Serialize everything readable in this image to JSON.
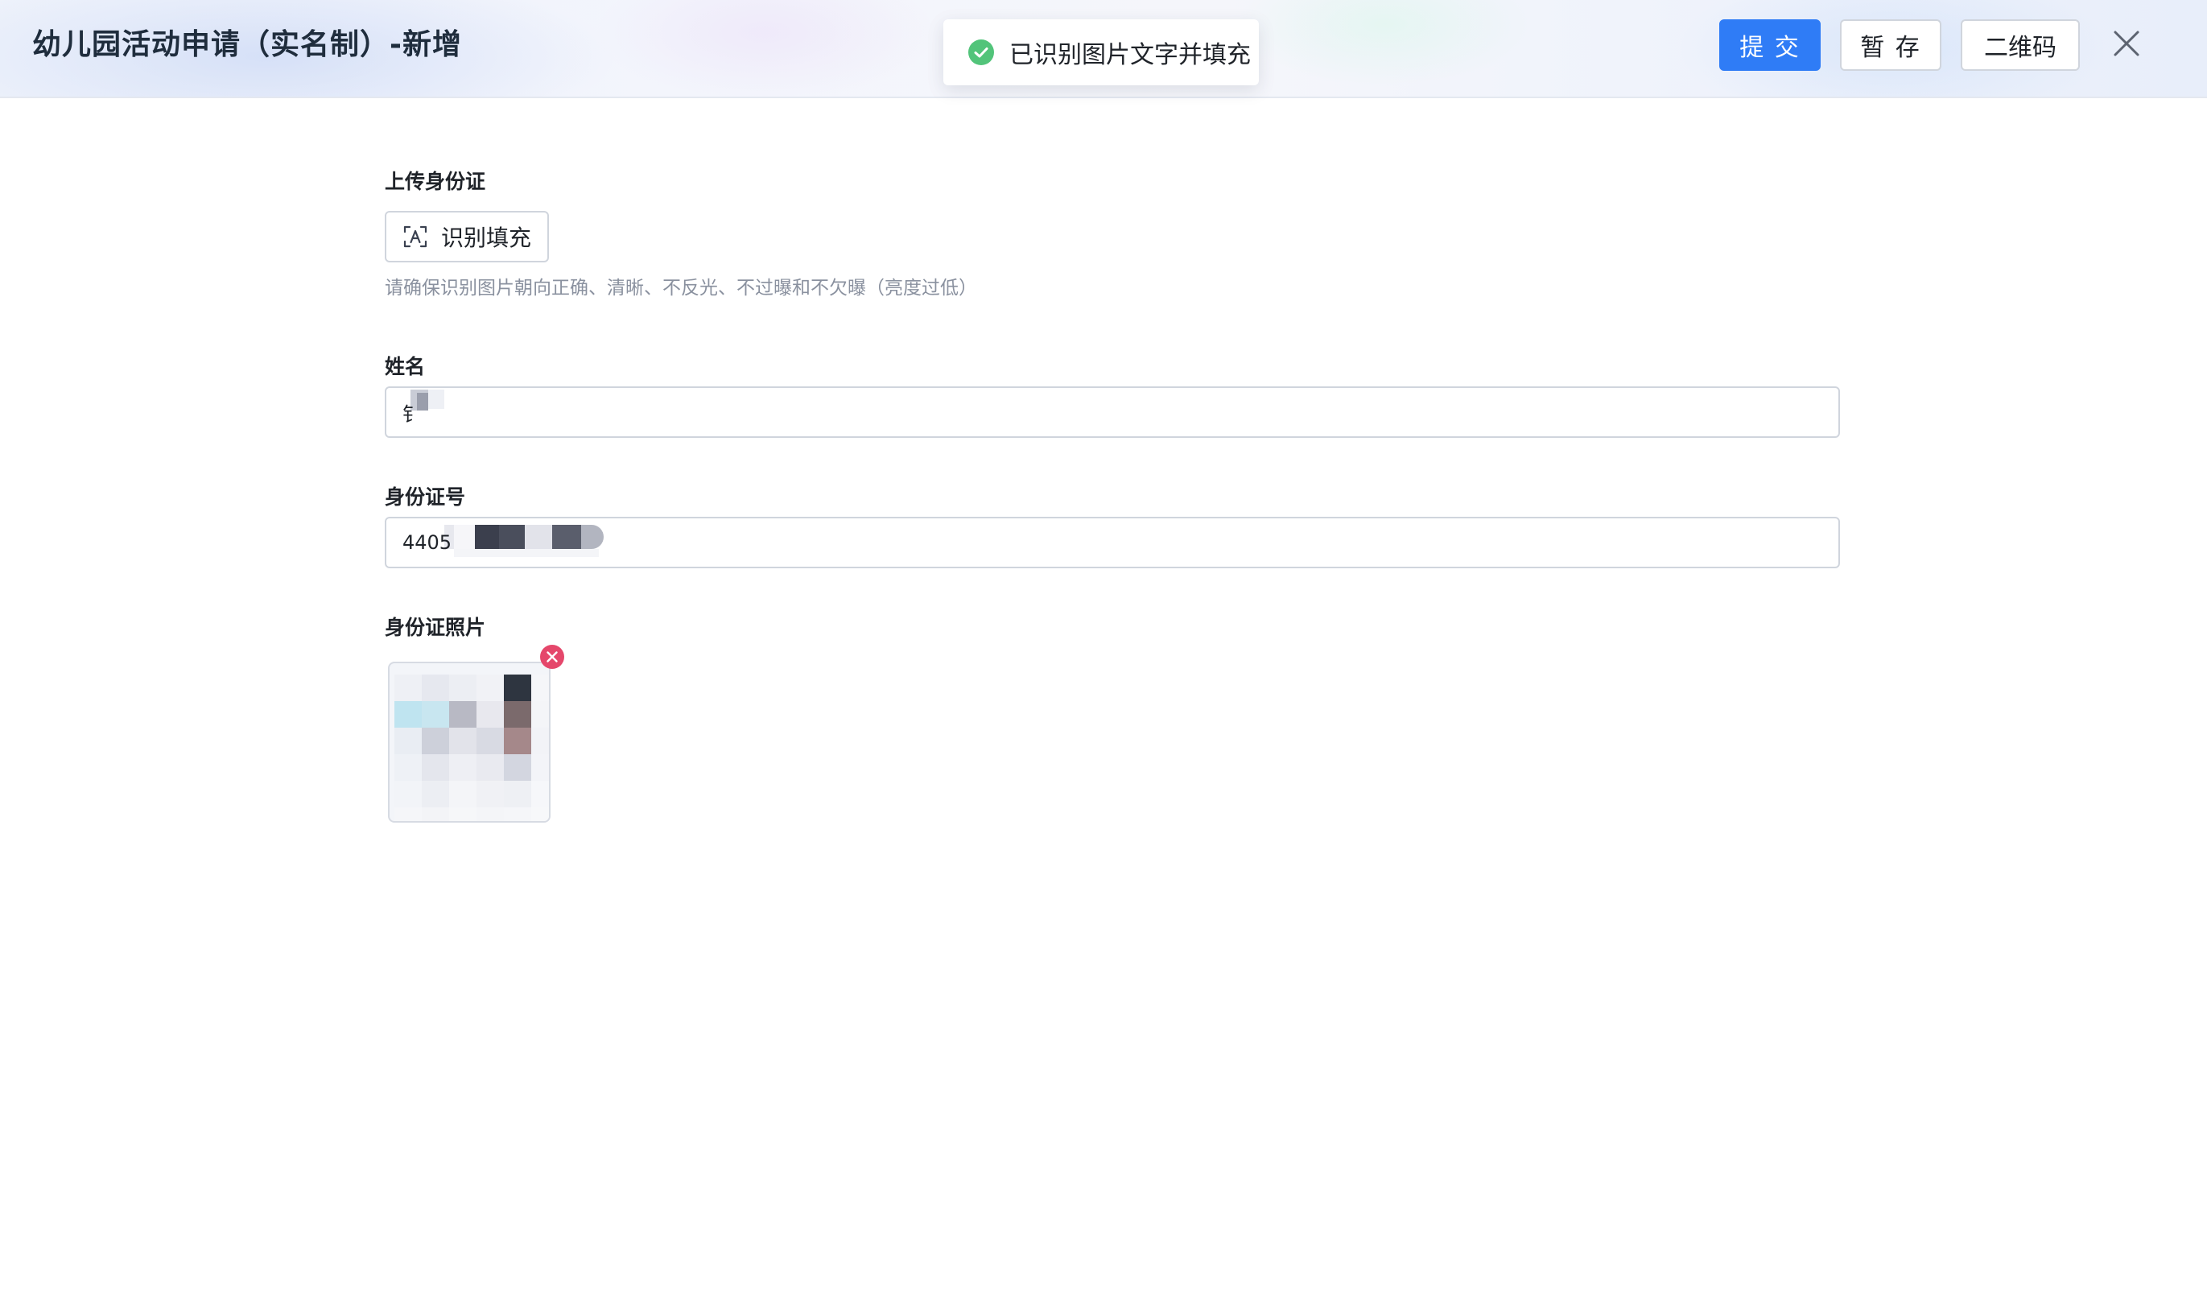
{
  "header": {
    "title": "幼儿园活动申请（实名制）-新增",
    "buttons": {
      "submit": "提 交",
      "save": "暂 存",
      "qrcode": "二维码"
    }
  },
  "toast": {
    "message": "已识别图片文字并填充",
    "status_color": "#52c47a"
  },
  "form": {
    "upload_label": "上传身份证",
    "ocr_button": "识别填充",
    "hint": "请确保识别图片朝向正确、清晰、不反光、不过曝和不欠曝（亮度过低）",
    "name_label": "姓名",
    "name_value": "钅",
    "id_label": "身份证号",
    "id_value": "4405",
    "photo_label": "身份证照片"
  },
  "colors": {
    "primary": "#2f7cf6",
    "danger": "#e5476b"
  }
}
